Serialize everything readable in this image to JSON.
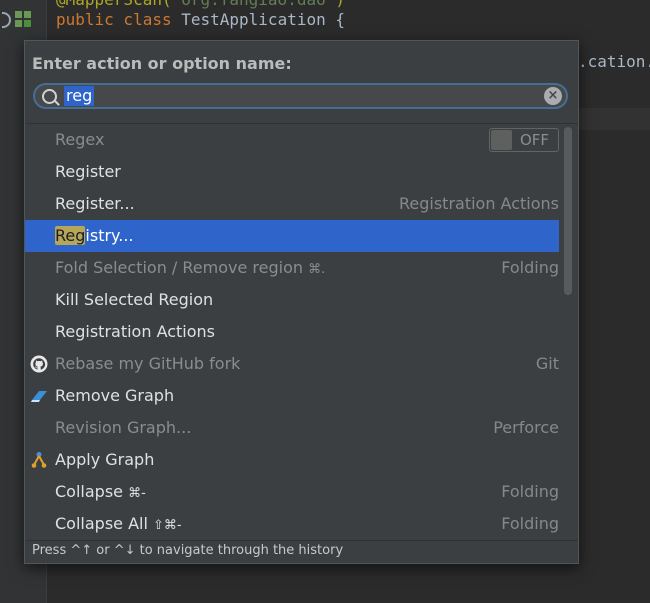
{
  "editor": {
    "line1_prefix": "@MapperScan(",
    "line1_string": "\"org.fangiao.dao\"",
    "line1_suffix": ")",
    "line2_keyword": "public class ",
    "line2_name": "TestApplication {",
    "right_fragment": ".cation./"
  },
  "popup": {
    "title": "Enter action or option name:",
    "search": {
      "query": "reg",
      "clear_icon": "×"
    },
    "rows": [
      {
        "label": "Regex",
        "right": "",
        "toggle": "OFF",
        "dim": true
      },
      {
        "label": "Register",
        "right": ""
      },
      {
        "label": "Register...",
        "right": "Registration Actions"
      },
      {
        "label_hl": "Reg",
        "label_rest": "istry...",
        "right": "",
        "selected": true
      },
      {
        "label": "Fold Selection / Remove region ",
        "shortcut": "⌘.",
        "right": "Folding",
        "dim": true
      },
      {
        "label": "Kill Selected Region",
        "right": ""
      },
      {
        "label": "Registration Actions",
        "right": ""
      },
      {
        "label": "Rebase my GitHub fork",
        "right": "Git",
        "dim": true,
        "icon": "github-icon"
      },
      {
        "label": "Remove Graph",
        "right": "",
        "icon": "eraser-icon"
      },
      {
        "label": "Revision Graph...",
        "right": "Perforce",
        "dim": true
      },
      {
        "label": "Apply Graph",
        "right": "",
        "icon": "graph-icon"
      },
      {
        "label": "Collapse ",
        "shortcut": "⌘-",
        "right": "Folding"
      },
      {
        "label": "Collapse All ",
        "shortcut": "⇧⌘-",
        "right": "Folding"
      }
    ],
    "hint": "Press ^↑ or ^↓ to navigate through the history"
  },
  "colors": {
    "selection": "#2f65ca",
    "popup_bg": "#3c3f41",
    "editor_bg": "#2b2b2b"
  }
}
